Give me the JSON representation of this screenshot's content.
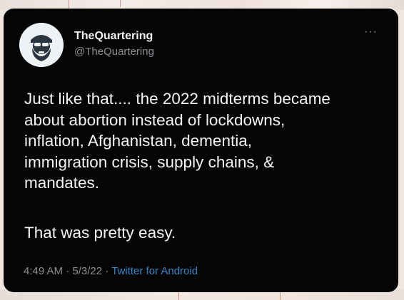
{
  "tweet": {
    "display_name": "TheQuartering",
    "handle": "@TheQuartering",
    "text_paragraph_1": "Just like that.... the 2022 midterms became\nabout abortion instead of lockdowns,\ninflation, Afghanistan, dementia,\nimmigration crisis, supply chains, &\nmandates.",
    "text_paragraph_2": "That was pretty easy.",
    "time": "4:49 AM",
    "date": "5/3/22",
    "separator": "·",
    "source": "Twitter for Android",
    "more_menu": "···"
  },
  "icons": {
    "avatar": "avatar-bearded-man-icon",
    "more": "more-options-icon"
  },
  "colors": {
    "card_background": "#050505",
    "text_primary": "#f4f4f4",
    "text_secondary": "#8b8f94",
    "link": "#2f86c8"
  }
}
